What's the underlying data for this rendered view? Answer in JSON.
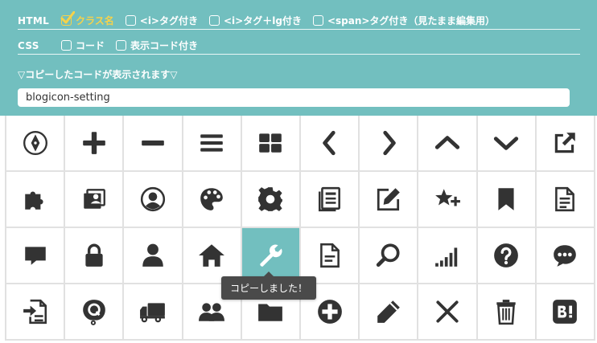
{
  "accent_color": "#72bfbf",
  "options": {
    "html": {
      "label": "HTML",
      "items": [
        {
          "label": "クラス名",
          "checked": true
        },
        {
          "label": "<i>タグ付き",
          "checked": false
        },
        {
          "label": "<i>タグ＋lg付き",
          "checked": false
        },
        {
          "label": "<span>タグ付き（見たまま編集用）",
          "checked": false
        }
      ]
    },
    "css": {
      "label": "CSS",
      "items": [
        {
          "label": "コード",
          "checked": false
        },
        {
          "label": "表示コード付き",
          "checked": false
        }
      ]
    }
  },
  "output": {
    "hint": "▽コピーしたコードが表示されます▽",
    "value": "blogicon-setting"
  },
  "tooltip": "コピーしました！",
  "icons": [
    [
      "pen-nib-icon",
      "plus-icon",
      "minus-icon",
      "menu-icon",
      "grid-icon",
      "chevron-left-icon",
      "chevron-right-icon",
      "chevron-up-icon",
      "chevron-down-icon",
      "external-link-icon"
    ],
    [
      "puzzle-icon",
      "profile-card-icon",
      "user-circle-icon",
      "palette-icon",
      "gear-icon",
      "news-icon",
      "edit-icon",
      "star-plus-icon",
      "bookmark-icon",
      "document-icon"
    ],
    [
      "comment-icon",
      "lock-icon",
      "person-icon",
      "home-icon",
      "wrench-icon",
      "file-text-icon",
      "search-icon",
      "signal-icon",
      "question-icon",
      "chat-dots-icon"
    ],
    [
      "import-icon",
      "q-balloon-icon",
      "truck-icon",
      "users-icon",
      "folder-icon",
      "plus-circle-icon",
      "pencil-icon",
      "close-icon",
      "trash-icon",
      "hatena-bookmark-icon"
    ]
  ],
  "active_icon": "wrench-icon"
}
